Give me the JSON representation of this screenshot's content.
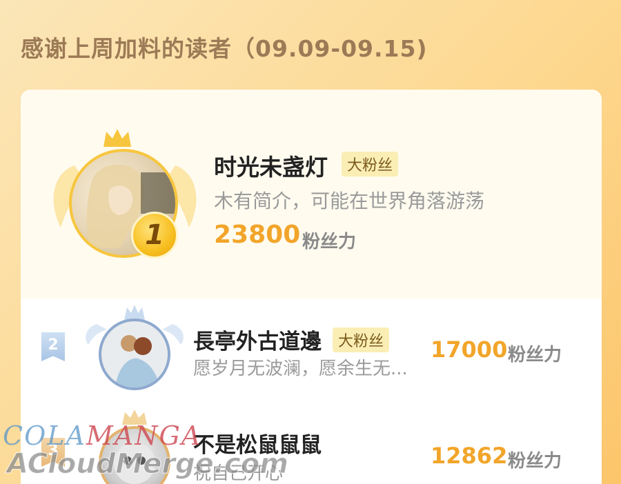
{
  "header": {
    "title": "感谢上周加料的读者（09.09-09.15)"
  },
  "fan_badge_label": "大粉丝",
  "fans_unit": "粉丝力",
  "readers": [
    {
      "rank": "1",
      "name": "时光未盏灯",
      "badge": "大粉丝",
      "intro": "木有简介，可能在世界角落游荡",
      "score": "23800",
      "unit": "粉丝力"
    },
    {
      "rank": "2",
      "name": "長亭外古道邊",
      "badge": "大粉丝",
      "intro": "愿岁月无波澜，愿余生无...",
      "score": "17000",
      "unit": "粉丝力"
    },
    {
      "rank": "3",
      "name": "不是松鼠鼠鼠",
      "intro": "祝自己开心",
      "score": "12862",
      "unit": "粉丝力"
    }
  ],
  "watermark": {
    "line1_a": "COLA",
    "line1_b": "MANGA",
    "line2": "ACloudMerge.com"
  },
  "colors": {
    "score": "#f2a52a",
    "title": "#9c7a56",
    "gold": "#f7c63e",
    "silver": "#8ea9cf",
    "bronze": "#e3b36e"
  }
}
